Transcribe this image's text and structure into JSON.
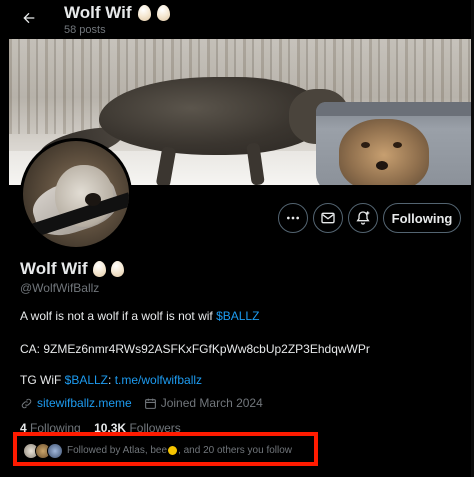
{
  "header": {
    "back_label": "Back",
    "title": "Wolf Wif",
    "post_count": "58 posts"
  },
  "colors": {
    "background": "#000000",
    "text_primary": "#e7e9ea",
    "text_secondary": "#71767b",
    "link": "#1d9bf0",
    "button_border": "#536471",
    "highlight_box": "#ff1b00"
  },
  "profile": {
    "name": "Wolf Wif",
    "name_emoji": "egg egg",
    "handle": "@WolfWifBallz",
    "bio_line1_text": "A wolf is not a wolf if a wolf is not wif ",
    "bio_line1_cashtag": "$BALLZ",
    "ca_line": "CA: 9ZMEz6nmr4RWs92ASFKxFGfKpWw8cbUp2ZP3EhdqwWPr",
    "tg_prefix": "TG WiF ",
    "tg_cashtag": "$BALLZ",
    "tg_colon": ": ",
    "tg_link": "t.me/wolfwifballz",
    "website": "sitewifballz.meme",
    "joined": "Joined March 2024",
    "following_count": "4",
    "following_label": "Following",
    "followers_count": "10.3K",
    "followers_label": "Followers"
  },
  "actions": {
    "more_icon": "ellipsis-icon",
    "message_icon": "envelope-icon",
    "notify_icon": "bell-plus-icon",
    "following_button": "Following"
  },
  "followed_by": {
    "prefix": "Followed by Atlas, bee",
    "emoji": "bee-emoji",
    "suffix": ", and 20 others you follow"
  }
}
